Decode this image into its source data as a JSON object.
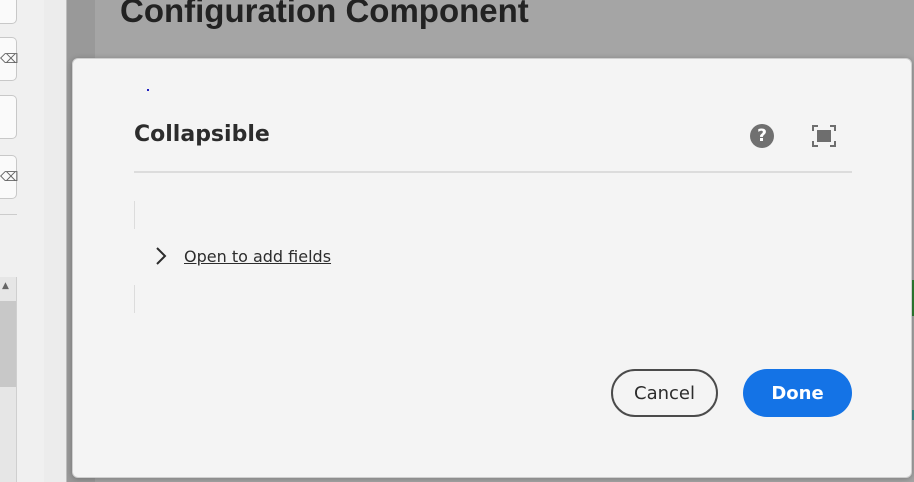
{
  "background": {
    "page_title": "Configuration Component",
    "left_icons": [
      "delete-icon",
      "delete-icon"
    ],
    "scroll_arrow": "▲"
  },
  "dialog": {
    "title": "Collapsible",
    "help_icon": "?",
    "collapsible_link": "Open to add fields",
    "cancel_label": "Cancel",
    "done_label": "Done",
    "accent_color": "#1473e6"
  }
}
